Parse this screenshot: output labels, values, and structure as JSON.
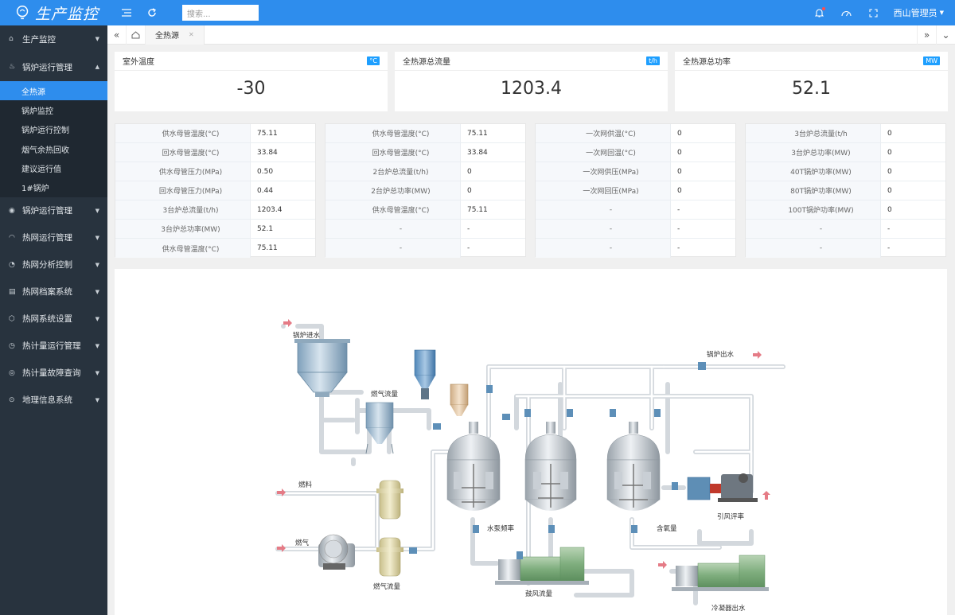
{
  "app": {
    "title": "生产监控"
  },
  "header": {
    "search_placeholder": "搜索...",
    "user": "西山管理员"
  },
  "sidebar": {
    "items": [
      {
        "label": "生产监控",
        "icon": "home-icon"
      },
      {
        "label": "锅炉运行管理",
        "icon": "flame-icon",
        "open": true
      },
      {
        "label": "锅炉运行管理",
        "icon": "compass-icon"
      },
      {
        "label": "热网运行管理",
        "icon": "gauge-icon"
      },
      {
        "label": "热网分析控制",
        "icon": "chart-icon"
      },
      {
        "label": "热网档案系统",
        "icon": "book-icon"
      },
      {
        "label": "热网系统设置",
        "icon": "cube-icon"
      },
      {
        "label": "热计量运行管理",
        "icon": "clock-icon"
      },
      {
        "label": "热计量故障查询",
        "icon": "alert-icon"
      },
      {
        "label": "地理信息系统",
        "icon": "location-icon"
      }
    ],
    "subitems": [
      "全热源",
      "锅炉监控",
      "锅炉运行控制",
      "烟气余热回收",
      "建议运行值",
      "1#锅炉"
    ]
  },
  "tabs": {
    "active": "全热源"
  },
  "cards": [
    {
      "title": "室外温度",
      "unit": "°C",
      "value": "-30"
    },
    {
      "title": "全热源总流量",
      "unit": "t/h",
      "value": "1203.4"
    },
    {
      "title": "全热源总功率",
      "unit": "MW",
      "value": "52.1"
    }
  ],
  "tables": [
    [
      [
        "供水母管温度(°C)",
        "75.11"
      ],
      [
        "回水母管温度(°C)",
        "33.84"
      ],
      [
        "供水母管压力(MPa)",
        "0.50"
      ],
      [
        "回水母管压力(MPa)",
        "0.44"
      ],
      [
        "3台炉总流量(t/h)",
        "1203.4"
      ],
      [
        "3台炉总功率(MW)",
        "52.1"
      ],
      [
        "供水母管温度(°C)",
        "75.11"
      ]
    ],
    [
      [
        "供水母管温度(°C)",
        "75.11"
      ],
      [
        "回水母管温度(°C)",
        "33.84"
      ],
      [
        "2台炉总流量(t/h)",
        "0"
      ],
      [
        "2台炉总功率(MW)",
        "0"
      ],
      [
        "供水母管温度(°C)",
        "75.11"
      ],
      [
        "-",
        "-"
      ],
      [
        "-",
        "-"
      ]
    ],
    [
      [
        "一次网供温(°C)",
        "0"
      ],
      [
        "一次网回温(°C)",
        "0"
      ],
      [
        "一次网供压(MPa)",
        "0"
      ],
      [
        "一次网回压(MPa)",
        "0"
      ],
      [
        "-",
        "-"
      ],
      [
        "-",
        "-"
      ],
      [
        "-",
        "-"
      ]
    ],
    [
      [
        "3台炉总流量(t/h",
        "0"
      ],
      [
        "3台炉总功率(MW)",
        "0"
      ],
      [
        "40T锅炉功率(MW)",
        "0"
      ],
      [
        "80T锅炉功率(MW)",
        "0"
      ],
      [
        "100T锅炉功率(MW)",
        "0"
      ],
      [
        "-",
        "-"
      ],
      [
        "-",
        "-"
      ]
    ]
  ],
  "diagram": {
    "labels": {
      "boiler_in": "锅炉进水",
      "boiler_out": "锅炉出水",
      "gas_flow_top": "燃气流量",
      "fuel": "燃料",
      "gas": "燃气",
      "gas_flow_bottom": "燃气流量",
      "pump_freq": "水泵频率",
      "oxygen": "含氧量",
      "draft_rate": "引风评率",
      "blower_flow": "鼓风流量",
      "condenser_out": "冷凝器出水"
    }
  }
}
